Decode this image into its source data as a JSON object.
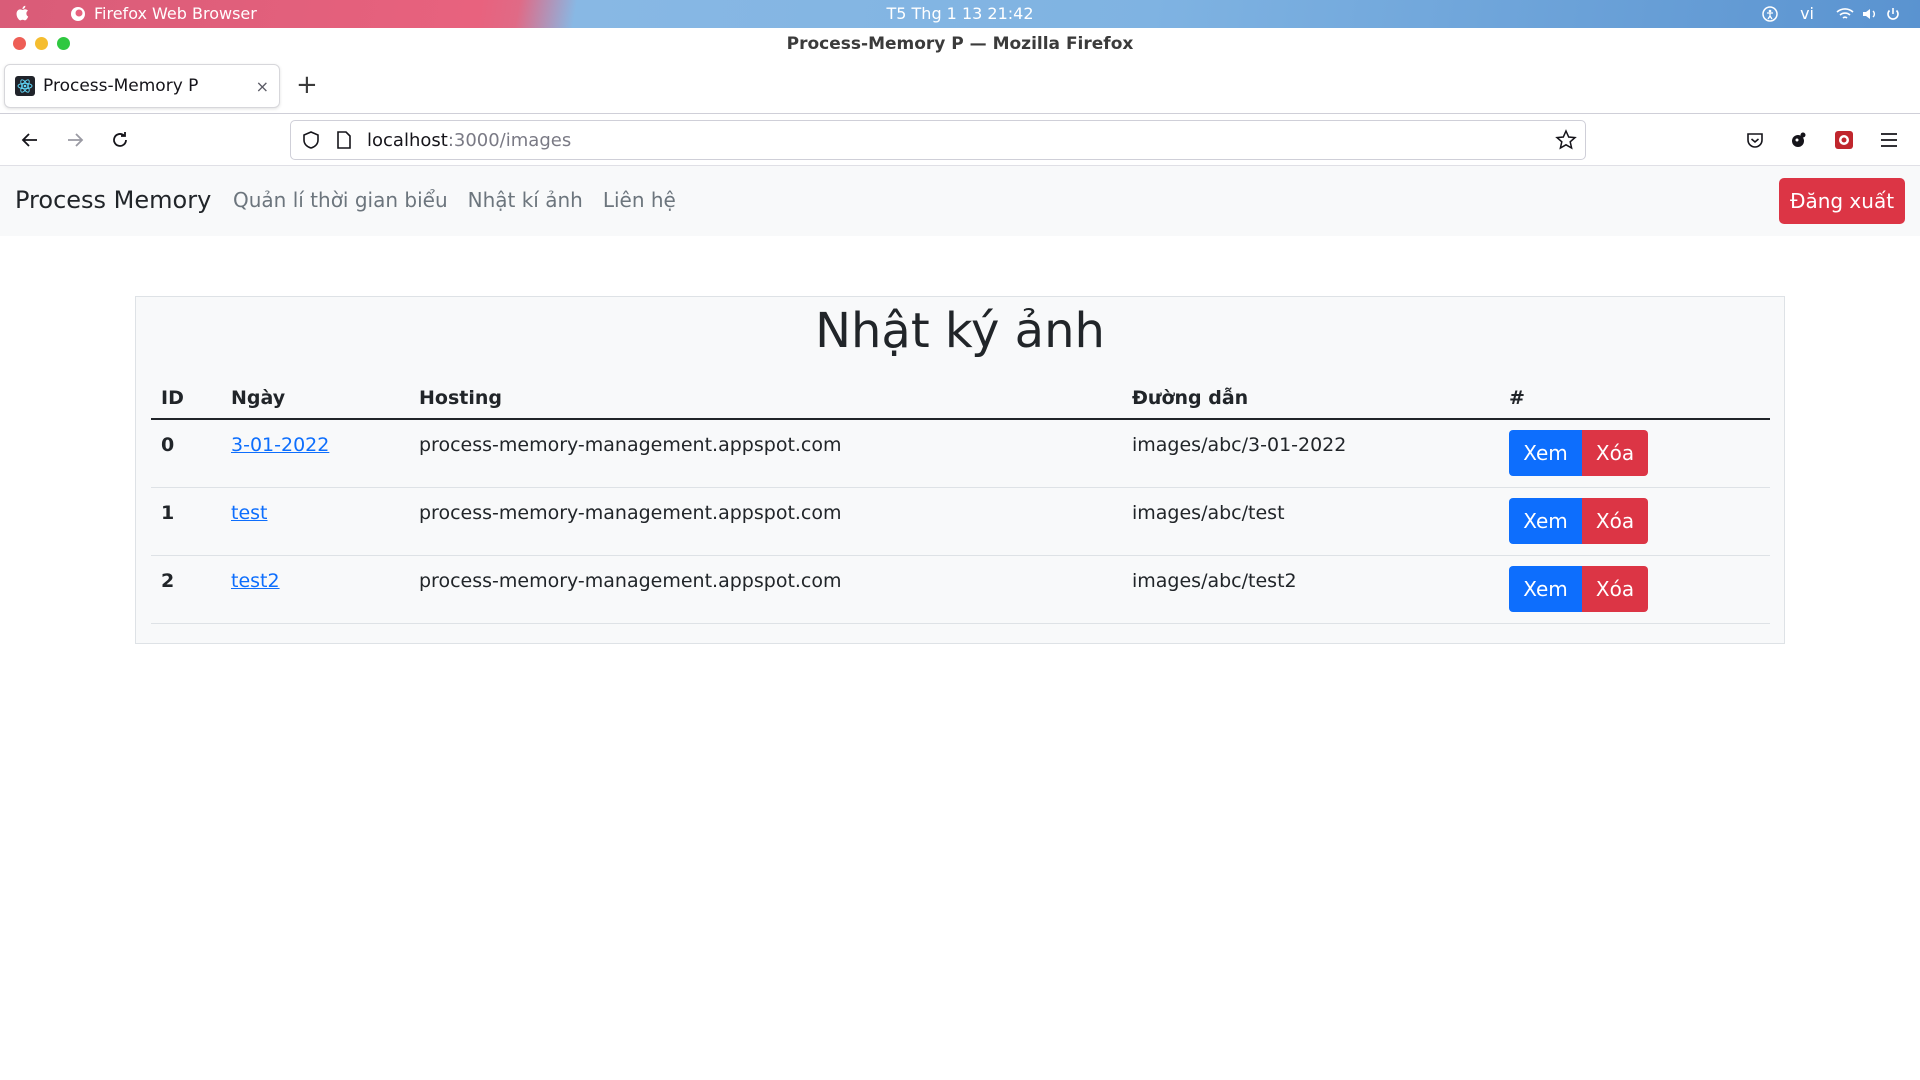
{
  "os": {
    "app_name": "Firefox Web Browser",
    "clock": "T5 Thg 1 13  21:42",
    "lang": "vi"
  },
  "window": {
    "title": "Process-Memory P — Mozilla Firefox"
  },
  "tab": {
    "title": "Process-Memory P",
    "close": "×",
    "new_tab": "+"
  },
  "urlbar": {
    "host": "localhost",
    "path": ":3000/images"
  },
  "navbar": {
    "brand": "Process Memory",
    "links": [
      "Quản lí thời gian biểu",
      "Nhật kí ảnh",
      "Liên hệ"
    ],
    "logout": "Đăng xuất"
  },
  "page": {
    "title": "Nhật ký ảnh",
    "columns": [
      "ID",
      "Ngày",
      "Hosting",
      "Đường dẫn",
      "#"
    ],
    "rows": [
      {
        "id": "0",
        "date": "3-01-2022",
        "hosting": "process-memory-management.appspot.com",
        "path": "images/abc/3-01-2022"
      },
      {
        "id": "1",
        "date": "test",
        "hosting": "process-memory-management.appspot.com",
        "path": "images/abc/test"
      },
      {
        "id": "2",
        "date": "test2",
        "hosting": "process-memory-management.appspot.com",
        "path": "images/abc/test2"
      }
    ],
    "view_label": "Xem",
    "delete_label": "Xóa"
  },
  "colors": {
    "primary": "#0d6efd",
    "danger": "#dc3545",
    "navbar_bg": "#f8f9fa"
  }
}
